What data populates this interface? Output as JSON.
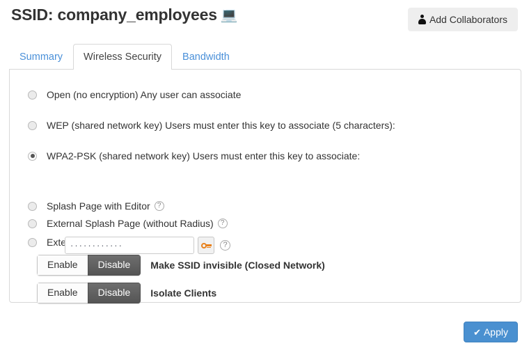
{
  "header": {
    "title": "SSID: company_employees",
    "device_icon": "💻",
    "collaborators_button": "Add Collaborators",
    "person_icon_name": "person-icon"
  },
  "tabs": [
    {
      "label": "Summary",
      "active": false
    },
    {
      "label": "Wireless Security",
      "active": true
    },
    {
      "label": "Bandwidth",
      "active": false
    }
  ],
  "security_options": [
    {
      "label": "Open (no encryption) Any user can associate",
      "selected": false,
      "help": false
    },
    {
      "label": "WEP (shared network key) Users must enter this key to associate (5 characters):",
      "selected": false,
      "help": false
    },
    {
      "label": "WPA2-PSK (shared network key) Users must enter this key to associate:",
      "selected": true,
      "help": false
    },
    {
      "label": "Splash Page with Editor",
      "selected": false,
      "help": true
    },
    {
      "label": "External Splash Page (without Radius)",
      "selected": false,
      "help": true
    },
    {
      "label": "External Splash Page with Radius",
      "selected": false,
      "help": true
    }
  ],
  "password_field": {
    "value": "············",
    "placeholder": "",
    "key_button_icon": "key-icon",
    "help_icon": "?"
  },
  "toggles": [
    {
      "enable_label": "Enable",
      "disable_label": "Disable",
      "active": "disable",
      "label": "Make SSID invisible (Closed Network)"
    },
    {
      "enable_label": "Enable",
      "disable_label": "Disable",
      "active": "disable",
      "label": "Isolate Clients"
    }
  ],
  "apply_button": {
    "label": "Apply",
    "check_glyph": "✔"
  },
  "help_glyph": "?",
  "colors": {
    "accent_blue": "#4a90d0",
    "link_blue": "#4a90d9",
    "toggle_active": "#5e5e5e",
    "key_orange": "#e8821e",
    "panel_border": "#d8d8d8"
  }
}
